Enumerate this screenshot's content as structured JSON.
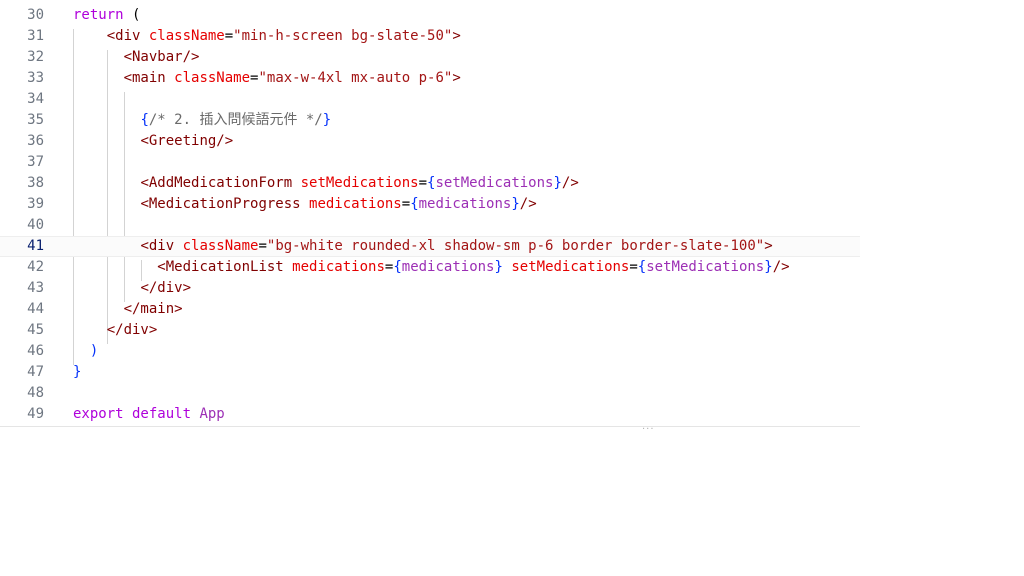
{
  "editor": {
    "lines": [
      {
        "n": "30",
        "tokens": [
          {
            "t": "return",
            "c": "kw"
          },
          {
            "t": " (",
            "c": "plain"
          }
        ]
      },
      {
        "n": "31",
        "tokens": [
          {
            "t": "    ",
            "c": "plain"
          },
          {
            "t": "<div",
            "c": "tag"
          },
          {
            "t": " className",
            "c": "attr"
          },
          {
            "t": "=",
            "c": "plain"
          },
          {
            "t": "\"min-h-screen bg-slate-50\"",
            "c": "str"
          },
          {
            "t": ">",
            "c": "tag"
          }
        ]
      },
      {
        "n": "32",
        "tokens": [
          {
            "t": "      ",
            "c": "plain"
          },
          {
            "t": "<Navbar/>",
            "c": "tag"
          }
        ]
      },
      {
        "n": "33",
        "tokens": [
          {
            "t": "      ",
            "c": "plain"
          },
          {
            "t": "<main",
            "c": "tag"
          },
          {
            "t": " className",
            "c": "attr"
          },
          {
            "t": "=",
            "c": "plain"
          },
          {
            "t": "\"max-w-4xl mx-auto p-6\"",
            "c": "str"
          },
          {
            "t": ">",
            "c": "tag"
          }
        ]
      },
      {
        "n": "34",
        "tokens": []
      },
      {
        "n": "35",
        "tokens": [
          {
            "t": "        ",
            "c": "plain"
          },
          {
            "t": "{",
            "c": "brace"
          },
          {
            "t": "/* 2. 插入問候語元件 */",
            "c": "cmt"
          },
          {
            "t": "}",
            "c": "brace"
          }
        ]
      },
      {
        "n": "36",
        "tokens": [
          {
            "t": "        ",
            "c": "plain"
          },
          {
            "t": "<Greeting/>",
            "c": "tag"
          }
        ]
      },
      {
        "n": "37",
        "tokens": []
      },
      {
        "n": "38",
        "tokens": [
          {
            "t": "        ",
            "c": "plain"
          },
          {
            "t": "<AddMedicationForm",
            "c": "tag"
          },
          {
            "t": " setMedications",
            "c": "attr"
          },
          {
            "t": "=",
            "c": "plain"
          },
          {
            "t": "{",
            "c": "brace"
          },
          {
            "t": "setMedications",
            "c": "var"
          },
          {
            "t": "}",
            "c": "brace"
          },
          {
            "t": "/>",
            "c": "tag"
          }
        ]
      },
      {
        "n": "39",
        "tokens": [
          {
            "t": "        ",
            "c": "plain"
          },
          {
            "t": "<MedicationProgress",
            "c": "tag"
          },
          {
            "t": " medications",
            "c": "attr"
          },
          {
            "t": "=",
            "c": "plain"
          },
          {
            "t": "{",
            "c": "brace"
          },
          {
            "t": "medications",
            "c": "var"
          },
          {
            "t": "}",
            "c": "brace"
          },
          {
            "t": "/>",
            "c": "tag"
          }
        ]
      },
      {
        "n": "40",
        "tokens": []
      },
      {
        "n": "41",
        "tokens": [
          {
            "t": "        ",
            "c": "plain"
          },
          {
            "t": "<div",
            "c": "tag"
          },
          {
            "t": " className",
            "c": "attr"
          },
          {
            "t": "=",
            "c": "plain"
          },
          {
            "t": "\"bg-white rounded-xl shadow-sm p-6 border border-slate-100\"",
            "c": "str"
          },
          {
            "t": ">",
            "c": "tag"
          }
        ],
        "current": true
      },
      {
        "n": "42",
        "tokens": [
          {
            "t": "          ",
            "c": "plain"
          },
          {
            "t": "<MedicationList",
            "c": "tag"
          },
          {
            "t": " medications",
            "c": "attr"
          },
          {
            "t": "=",
            "c": "plain"
          },
          {
            "t": "{",
            "c": "brace"
          },
          {
            "t": "medications",
            "c": "var"
          },
          {
            "t": "}",
            "c": "brace"
          },
          {
            "t": " setMedications",
            "c": "attr"
          },
          {
            "t": "=",
            "c": "plain"
          },
          {
            "t": "{",
            "c": "brace"
          },
          {
            "t": "setMedications",
            "c": "var"
          },
          {
            "t": "}",
            "c": "brace"
          },
          {
            "t": "/>",
            "c": "tag"
          }
        ]
      },
      {
        "n": "43",
        "tokens": [
          {
            "t": "        ",
            "c": "plain"
          },
          {
            "t": "</div>",
            "c": "tag"
          }
        ]
      },
      {
        "n": "44",
        "tokens": [
          {
            "t": "      ",
            "c": "plain"
          },
          {
            "t": "</main>",
            "c": "tag"
          }
        ]
      },
      {
        "n": "45",
        "tokens": [
          {
            "t": "    ",
            "c": "plain"
          },
          {
            "t": "</div>",
            "c": "tag"
          }
        ]
      },
      {
        "n": "46",
        "tokens": [
          {
            "t": "  )",
            "c": "brace"
          }
        ]
      },
      {
        "n": "47",
        "tokens": [
          {
            "t": "}",
            "c": "brace"
          }
        ]
      },
      {
        "n": "48",
        "tokens": []
      },
      {
        "n": "49",
        "tokens": [
          {
            "t": "export",
            "c": "kw"
          },
          {
            "t": " default",
            "c": "kw"
          },
          {
            "t": " App",
            "c": "var"
          }
        ]
      }
    ],
    "scroll_hint": "..."
  }
}
